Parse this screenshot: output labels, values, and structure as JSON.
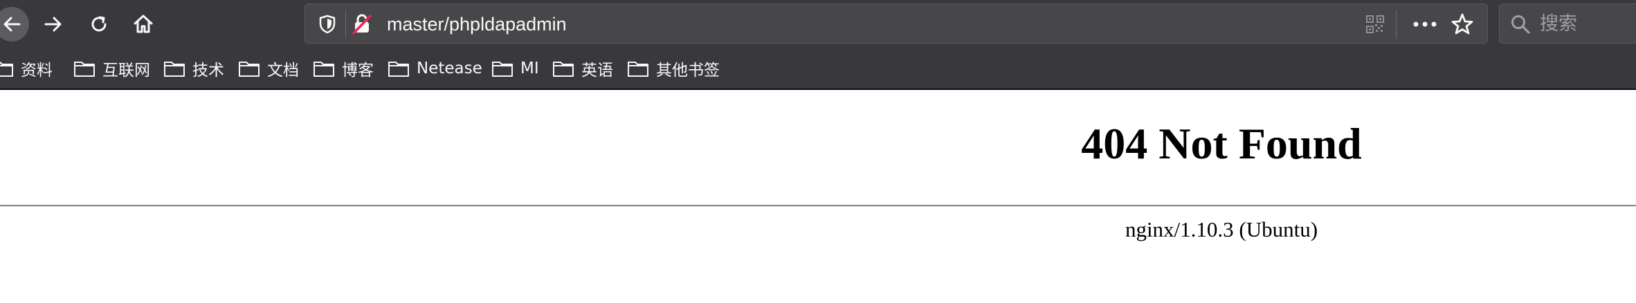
{
  "toolbar": {
    "url": "master/phpldapadmin",
    "search_placeholder": "搜索"
  },
  "bookmarks": [
    {
      "label": "资料"
    },
    {
      "label": "互联网"
    },
    {
      "label": "技术"
    },
    {
      "label": "文档"
    },
    {
      "label": "博客"
    },
    {
      "label": "Netease"
    },
    {
      "label": "MI"
    },
    {
      "label": "英语"
    },
    {
      "label": "其他书签"
    }
  ],
  "page": {
    "title": "404 Not Found",
    "server": "nginx/1.10.3 (Ubuntu)"
  },
  "colors": {
    "toolbar_bg": "#38383d",
    "urlbar_bg": "#474749",
    "text_light": "#f9f9fa"
  },
  "icons": [
    "back-arrow-icon",
    "forward-arrow-icon",
    "reload-icon",
    "home-icon",
    "shield-icon",
    "insecure-lock-icon",
    "qr-code-icon",
    "more-icon",
    "star-icon",
    "search-icon",
    "folder-icon"
  ]
}
